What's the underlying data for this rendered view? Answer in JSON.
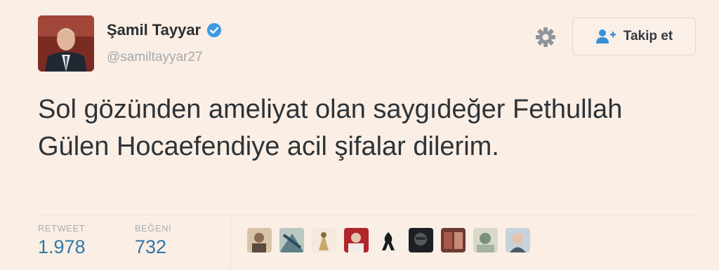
{
  "user": {
    "display_name": "Şamil Tayyar",
    "handle": "@samiltayyar27",
    "verified": true
  },
  "actions": {
    "follow_label": "Takip et"
  },
  "tweet": {
    "text": "Sol gözünden ameliyat olan saygıdeğer Fethullah Gülen Hocaefendiye acil şifalar dilerim."
  },
  "stats": {
    "retweet_label": "RETWEET",
    "retweet_count": "1.978",
    "like_label": "BEĞENİ",
    "like_count": "732"
  },
  "colors": {
    "background": "#fbeee4",
    "link_blue": "#2d78a8",
    "verified_blue": "#3b9be0",
    "muted_gray": "#a4a9ad"
  },
  "icons": {
    "verified": "verified-badge-icon",
    "settings": "gear-icon",
    "follow": "add-user-icon"
  },
  "liker_avatar_count": 9
}
